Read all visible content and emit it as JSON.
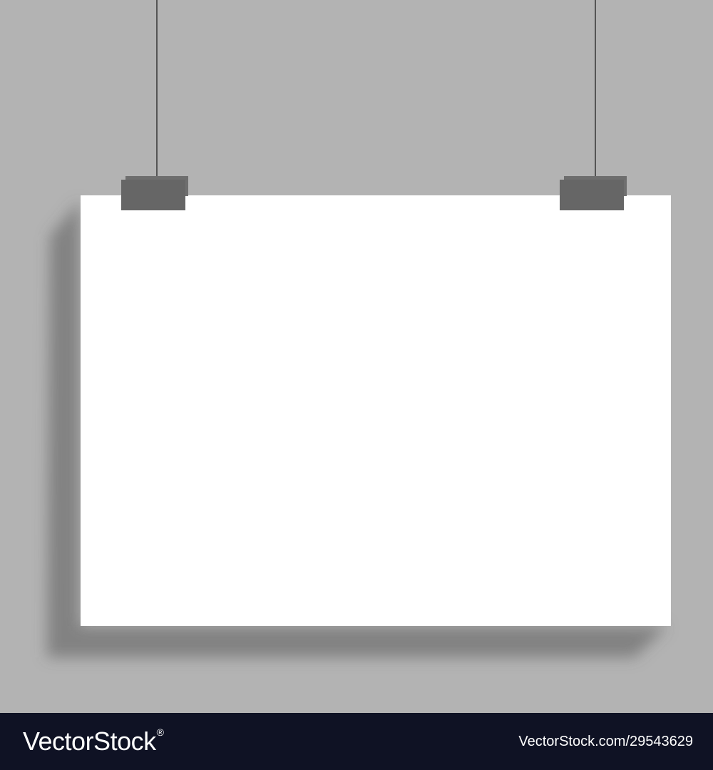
{
  "colors": {
    "wall": "#b3b3b3",
    "paper": "#ffffff",
    "shadow": "#5a5a5a",
    "clip": "#666666",
    "clip_top": "#6e6e6e",
    "string": "#555555",
    "footer_bg": "#0f1224",
    "footer_text": "#ffffff"
  },
  "watermark": {
    "logo_text": "VectorStock",
    "registered_mark": "®",
    "image_id": "VectorStock.com/29543629"
  }
}
